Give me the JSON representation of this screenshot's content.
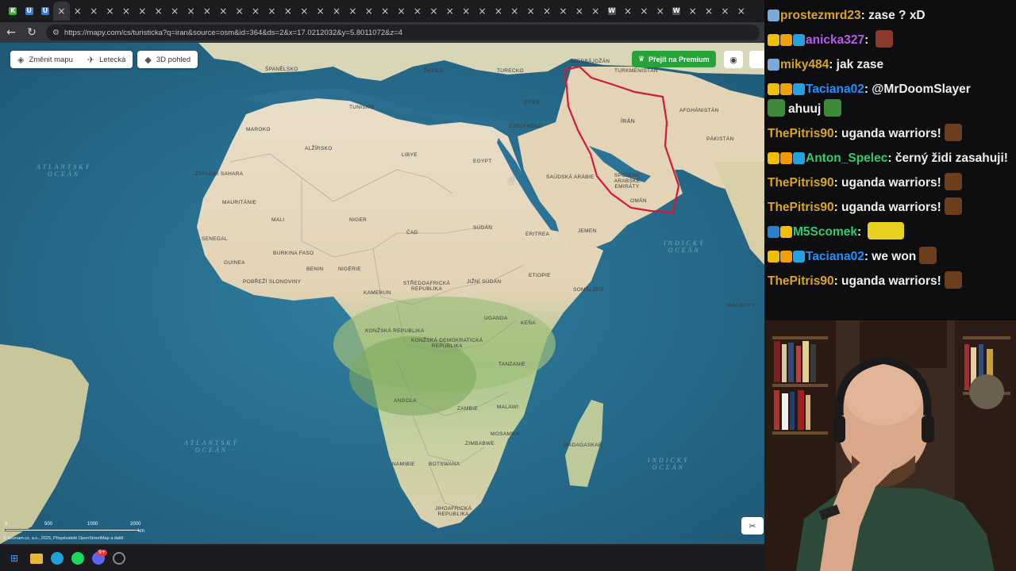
{
  "browser": {
    "tabs": [
      "K",
      "U",
      "U",
      "×",
      "×",
      "×",
      "×",
      "×",
      "×",
      "×",
      "×",
      "×",
      "×",
      "×",
      "×",
      "×",
      "×",
      "×",
      "×",
      "×",
      "×",
      "×",
      "×",
      "×",
      "×",
      "×",
      "×",
      "×",
      "×",
      "×",
      "×",
      "×",
      "×",
      "×",
      "×",
      "×",
      "×",
      "W",
      "×",
      "×",
      "×",
      "W",
      "×",
      "×",
      "×",
      "×"
    ],
    "url": "https://mapy.com/cs/turisticka?q=iran&source=osm&id=364&ds=2&x=17.0212032&y=5.8011072&z=4",
    "back_icon": "back-arrow-icon",
    "reload_icon": "reload-icon"
  },
  "map": {
    "buttons": {
      "change_map": "Změnit mapu",
      "aerial": "Letecká",
      "view_3d": "3D pohled",
      "premium": "Přejít na Premium"
    },
    "scale_ticks": [
      "0",
      "500",
      "1000",
      "2000"
    ],
    "scale_unit": "km",
    "credits": "© Seznam.cz, a.s., 2025, Přispěvatelé OpenStreetMap a další",
    "oceans": [
      {
        "name": "Atlantský oceán",
        "line1": "ATLANTSKÝ",
        "line2": "OCEÁN"
      },
      {
        "name": "Atlantský oceán 2",
        "line1": "ATLANTSKÝ",
        "line2": "OCEÁN"
      },
      {
        "name": "Indický oceán",
        "line1": "INDICKÝ",
        "line2": "OCEÁN"
      },
      {
        "name": "Indický oceán 2",
        "line1": "INDICKÝ",
        "line2": "OCEÁN"
      }
    ],
    "countries": {
      "spanelsko": "ŠPANĚLSKO",
      "recko": "ŘECKO",
      "turecko": "TURECKO",
      "azerbajdzan": "AZERBÁJDŽÁN",
      "turkmenistan": "TURKMENISTÁN",
      "tunisko": "TUNISKO",
      "syrie": "SÝRIE",
      "afghanistan": "AFGHÁNISTÁN",
      "maroko": "MAROKO",
      "jordansko": "JORDÁNSKO",
      "iran": "ÍRÁN",
      "alzirsko": "ALŽÍRSKO",
      "libye": "LIBYE",
      "pakistan": "PÁKISTÁN",
      "egypt": "EGYPT",
      "zapadni_sahara": "ZÁPADNÍ SAHARA",
      "saudska_arabie": "SAÚDSKÁ ARÁBIE",
      "emiraty": "SPOJENÉ ARABSKÉ EMIRÁTY",
      "mauritanie": "MAURITÁNIE",
      "mali": "MALI",
      "niger": "NIGER",
      "oman": "OMÁN",
      "cad": "ČAD",
      "sudan": "SÚDÁN",
      "jemen": "JEMEN",
      "senegal": "SENEGAL",
      "eritrea": "ERITREA",
      "burkina": "BURKINA FASO",
      "guinea": "GUINEA",
      "benin": "BENIN",
      "nigerie": "NIGÉRIE",
      "etiopie": "ETIOPIE",
      "pobrezi": "POBŘEŽÍ SLONOVINY",
      "stredoafricka": "STŘEDOAFRICKÁ",
      "stredoafricka2": "REPUBLIKA",
      "jizni_sudan": "JIŽNÍ SÚDÁN",
      "kamerun": "KAMERUN",
      "somalsko": "SOMÁLSKO",
      "maledivy": "MALEDIVY",
      "uganda": "UGANDA",
      "kena": "KEŇA",
      "konzska": "KONŽSKÁ REPUBLIKA",
      "drc1": "KONŽSKÁ DEMOKRATICKÁ",
      "drc2": "REPUBLIKA",
      "tanzanie": "TANZANIE",
      "angola": "ANGOLA",
      "malawi": "MALAWI",
      "zambie": "ZAMBIE",
      "mosambik": "MOSAMBIK",
      "zimbabwe": "ZIMBABWE",
      "madagaskar": "MADAGASKAR",
      "namibie": "NAMIBIE",
      "botswana": "BOTSWANA",
      "jihoafricka1": "JIHOAFRICKÁ",
      "jihoafricka2": "REPUBLIKA"
    },
    "highlight_color": "#d6163a"
  },
  "taskbar": {
    "icons": [
      "windows-start-icon",
      "file-explorer-icon",
      "edge-icon",
      "spotify-icon",
      "discord-icon",
      "chrome-icon"
    ],
    "discord_badge": "9+"
  },
  "chat": {
    "messages": [
      {
        "user": "prostezmrd23",
        "text": "zase ? xD",
        "color": "#daa520",
        "badges": [
          "#7aa9d8"
        ]
      },
      {
        "user": "anicka327",
        "text": "",
        "color": "#b65ee8",
        "badges": [
          "#f0c000",
          "#f0a000",
          "#24a3e0"
        ],
        "emote": "#8a3a2a"
      },
      {
        "user": "miky484",
        "text": "jak zase",
        "color": "#daa520",
        "badges": [
          "#7aa9d8"
        ]
      },
      {
        "user": "Taciana02",
        "text": "@MrDoomSlayer",
        "text2": "ahuuj",
        "color": "#1e90ff",
        "badges": [
          "#f0c000",
          "#f0a000",
          "#24a3e0"
        ],
        "emote": "#3f8a3a"
      },
      {
        "user": "ThePitris90",
        "text": "uganda warriors!",
        "color": "#daa520",
        "badges": [],
        "emote": "#6b3e1e"
      },
      {
        "user": "Anton_Spelec",
        "text": "černý židi zasahuji!",
        "color": "#2ecc71",
        "badges": [
          "#f0c000",
          "#f09a00",
          "#24a3e0"
        ]
      },
      {
        "user": "ThePitris90",
        "text": "uganda warriors!",
        "color": "#daa520",
        "badges": [],
        "emote": "#6b3e1e"
      },
      {
        "user": "ThePitris90",
        "text": "uganda warriors!",
        "color": "#daa520",
        "badges": [],
        "emote": "#6b3e1e"
      },
      {
        "user": "M5Scomek",
        "text": "",
        "color": "#2ecc71",
        "badges": [
          "#2a7fd0",
          "#f0c000"
        ],
        "emote": "#e8d020"
      },
      {
        "user": "Taciana02",
        "text": "we won",
        "color": "#1e90ff",
        "badges": [
          "#f0c000",
          "#f0a000",
          "#24a3e0"
        ],
        "emote": "#6b3e1e"
      },
      {
        "user": "ThePitris90",
        "text": "uganda warriors!",
        "color": "#daa520",
        "badges": [],
        "emote": "#6b3e1e"
      }
    ]
  }
}
